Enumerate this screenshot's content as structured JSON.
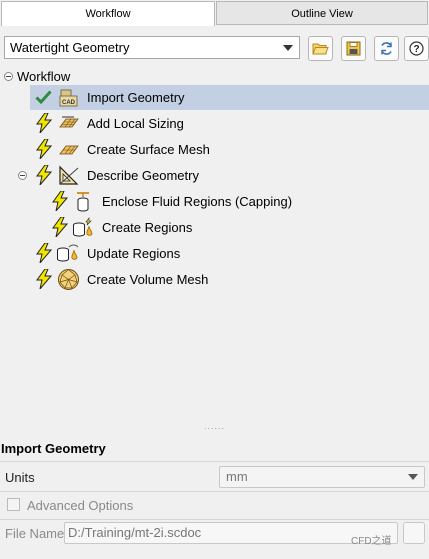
{
  "tabs": [
    {
      "label": "Workflow",
      "active": true
    },
    {
      "label": "Outline View",
      "active": false
    }
  ],
  "toolbar": {
    "workflow_type": "Watertight Geometry",
    "buttons": [
      "open-folder-icon",
      "save-icon",
      "refresh-icon",
      "help-icon"
    ],
    "help_glyph": "?"
  },
  "tree": {
    "root_label": "Workflow",
    "items": [
      {
        "label": "Import Geometry",
        "status": "done",
        "icon": "cad-import-icon",
        "selected": true
      },
      {
        "label": "Add Local Sizing",
        "status": "pending",
        "icon": "local-sizing-icon"
      },
      {
        "label": "Create Surface Mesh",
        "status": "pending",
        "icon": "surface-mesh-icon"
      },
      {
        "label": "Describe Geometry",
        "status": "pending",
        "icon": "describe-geometry-icon",
        "expanded": true,
        "children": [
          {
            "label": "Enclose Fluid Regions (Capping)",
            "status": "pending",
            "icon": "capping-icon"
          },
          {
            "label": "Create Regions",
            "status": "pending",
            "icon": "create-regions-icon"
          }
        ]
      },
      {
        "label": "Update Regions",
        "status": "pending",
        "icon": "update-regions-icon"
      },
      {
        "label": "Create Volume Mesh",
        "status": "pending",
        "icon": "volume-mesh-icon"
      }
    ]
  },
  "splitter_grip": "......",
  "properties": {
    "title": "Import Geometry",
    "units_label": "Units",
    "units_value": "mm",
    "advanced_label": "Advanced Options",
    "filename_label": "File Name",
    "filename_value": "D:/Training/mt-2i.scdoc"
  },
  "watermark": "CFD之道",
  "colors": {
    "selection": "#c3cfe3",
    "check": "#2e8b3d",
    "bolt": "#f2e600"
  }
}
